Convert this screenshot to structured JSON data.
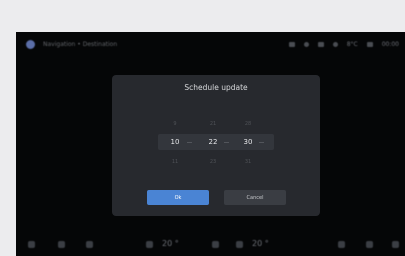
{
  "statusbar": {
    "title": "Navigation • Destination",
    "time": "Time",
    "temp": "8°C",
    "clock": "00:00"
  },
  "dialog": {
    "title": "Schedule update",
    "picker": {
      "prev_row": [
        "9",
        "21",
        "28"
      ],
      "selected_row": [
        "10",
        "22",
        "30"
      ],
      "next_row": [
        "11",
        "23",
        "31"
      ]
    },
    "ok_label": "Ok",
    "cancel_label": "Cancel"
  },
  "bottombar": {
    "left_temp": "20 °",
    "right_temp": "20 °"
  },
  "colors": {
    "accent": "#4a84d4",
    "dialog_bg": "#27292e",
    "screen_bg": "#050607"
  }
}
